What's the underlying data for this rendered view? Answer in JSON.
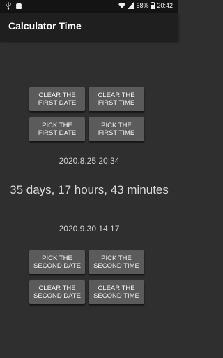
{
  "status": {
    "battery": "68%",
    "time": "20:42"
  },
  "app": {
    "title": "Calculator Time"
  },
  "first": {
    "clear_date": "CLEAR THE FIRST DATE",
    "clear_time": "CLEAR THE FIRST TIME",
    "pick_date": "PICK THE FIRST DATE",
    "pick_time": "PICK THE FIRST TIME",
    "value": "2020.8.25 20:34"
  },
  "result": {
    "duration": "35 days, 17 hours, 43 minutes"
  },
  "second": {
    "value": "2020.9.30 14:17",
    "pick_date": "PICK THE SECOND DATE",
    "pick_time": "PICK THE SECOND TIME",
    "clear_date": "CLEAR THE SECOND DATE",
    "clear_time": "CLEAR THE SECOND TIME"
  },
  "colors": {
    "background": "#2f2f2f",
    "app_bar": "#1f1f1f",
    "button": "#5b5b5b"
  }
}
